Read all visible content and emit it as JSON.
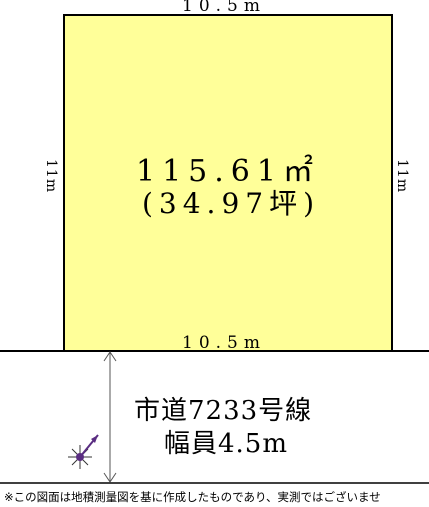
{
  "lot": {
    "top_width": "10.5m",
    "bottom_width": "10.5m",
    "left_depth": "11m",
    "right_depth": "11m",
    "area_sqm": "115.61㎡",
    "area_tsubo": "(34.97坪)"
  },
  "road": {
    "name": "市道7233号線",
    "width": "幅員4.5m"
  },
  "disclaimer": "※この図面は地積測量図を基に作成したものであり、実測ではございませ",
  "colors": {
    "lot_fill": "#ffff99",
    "line": "#000000",
    "compass": "#5a2d82"
  }
}
